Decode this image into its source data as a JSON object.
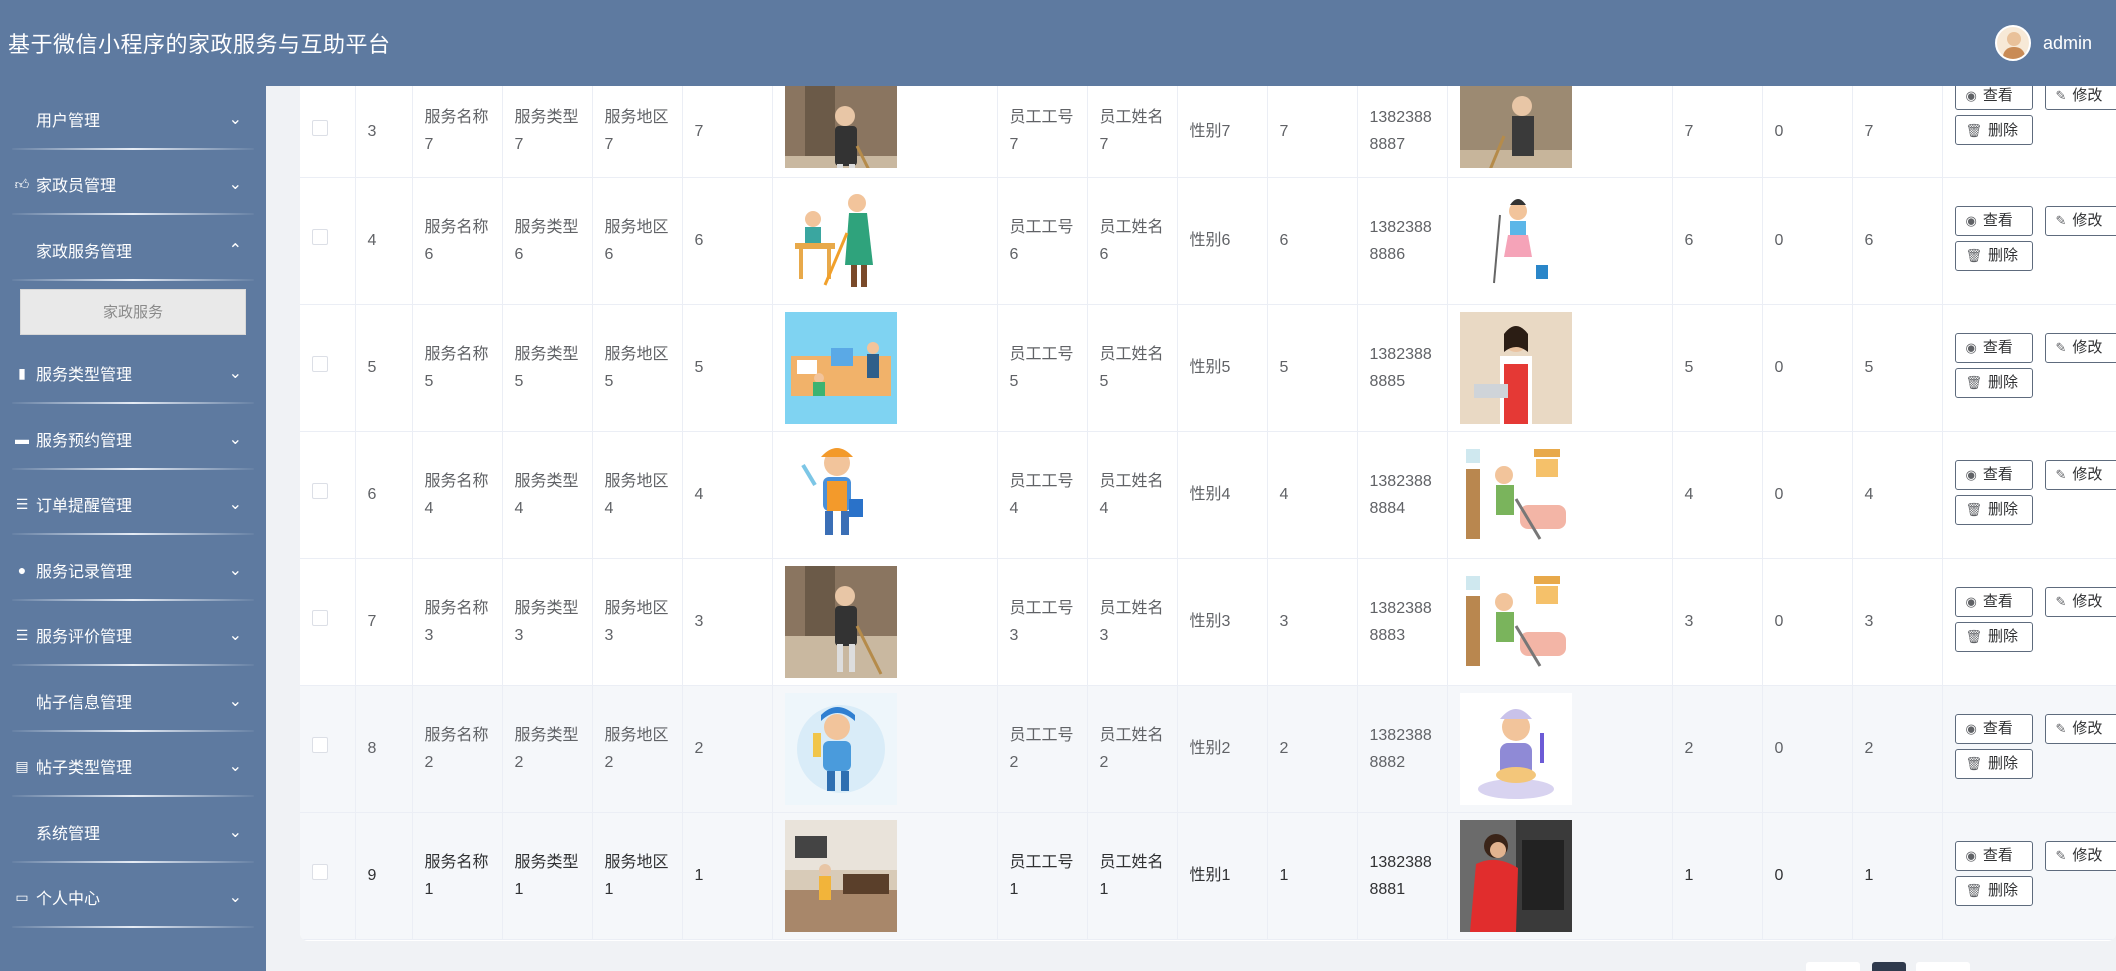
{
  "header": {
    "title": "基于微信小程序的家政服务与互助平台",
    "username": "admin"
  },
  "sidebar": {
    "items": [
      {
        "label": "用户管理",
        "icon": "grid-icon",
        "expanded": false
      },
      {
        "label": "家政员管理",
        "icon": "thumb-icon",
        "expanded": false
      },
      {
        "label": "家政服务管理",
        "icon": "grid-icon",
        "expanded": true,
        "submenu": [
          "家政服务"
        ]
      },
      {
        "label": "服务类型管理",
        "icon": "book-icon",
        "expanded": false
      },
      {
        "label": "服务预约管理",
        "icon": "briefcase-icon",
        "expanded": false
      },
      {
        "label": "订单提醒管理",
        "icon": "sliders-icon",
        "expanded": false
      },
      {
        "label": "服务记录管理",
        "icon": "bulb-icon",
        "expanded": false
      },
      {
        "label": "服务评价管理",
        "icon": "list-icon",
        "expanded": false
      },
      {
        "label": "帖子信息管理",
        "icon": "grid-icon",
        "expanded": false
      },
      {
        "label": "帖子类型管理",
        "icon": "clipboard-icon",
        "expanded": false
      },
      {
        "label": "系统管理",
        "icon": "grid-icon",
        "expanded": false
      },
      {
        "label": "个人中心",
        "icon": "card-icon",
        "expanded": false
      }
    ]
  },
  "actions": {
    "view": "查看",
    "edit": "修改",
    "delete": "删除"
  },
  "rows": [
    {
      "index": "3",
      "service_name": "服务名称7",
      "service_type": "服务类型7",
      "area": "服务地区7",
      "price": "7",
      "emp_no": "员工工号7",
      "emp_name": "员工姓名7",
      "gender": "性别7",
      "age": "7",
      "phone": "13823888887",
      "c1": "7",
      "c2": "0",
      "c3": "7"
    },
    {
      "index": "4",
      "service_name": "服务名称6",
      "service_type": "服务类型6",
      "area": "服务地区6",
      "price": "6",
      "emp_no": "员工工号6",
      "emp_name": "员工姓名6",
      "gender": "性别6",
      "age": "6",
      "phone": "13823888886",
      "c1": "6",
      "c2": "0",
      "c3": "6"
    },
    {
      "index": "5",
      "service_name": "服务名称5",
      "service_type": "服务类型5",
      "area": "服务地区5",
      "price": "5",
      "emp_no": "员工工号5",
      "emp_name": "员工姓名5",
      "gender": "性别5",
      "age": "5",
      "phone": "13823888885",
      "c1": "5",
      "c2": "0",
      "c3": "5"
    },
    {
      "index": "6",
      "service_name": "服务名称4",
      "service_type": "服务类型4",
      "area": "服务地区4",
      "price": "4",
      "emp_no": "员工工号4",
      "emp_name": "员工姓名4",
      "gender": "性别4",
      "age": "4",
      "phone": "13823888884",
      "c1": "4",
      "c2": "0",
      "c3": "4"
    },
    {
      "index": "7",
      "service_name": "服务名称3",
      "service_type": "服务类型3",
      "area": "服务地区3",
      "price": "3",
      "emp_no": "员工工号3",
      "emp_name": "员工姓名3",
      "gender": "性别3",
      "age": "3",
      "phone": "13823888883",
      "c1": "3",
      "c2": "0",
      "c3": "3"
    },
    {
      "index": "8",
      "service_name": "服务名称2",
      "service_type": "服务类型2",
      "area": "服务地区2",
      "price": "2",
      "emp_no": "员工工号2",
      "emp_name": "员工姓名2",
      "gender": "性别2",
      "age": "2",
      "phone": "13823888882",
      "c1": "2",
      "c2": "0",
      "c3": "2"
    },
    {
      "index": "9",
      "service_name": "服务名称1",
      "service_type": "服务类型1",
      "area": "服务地区1",
      "price": "1",
      "emp_no": "员工工号1",
      "emp_name": "员工姓名1",
      "gender": "性别1",
      "age": "1",
      "phone": "13823888881",
      "c1": "1",
      "c2": "0",
      "c3": "1"
    }
  ]
}
